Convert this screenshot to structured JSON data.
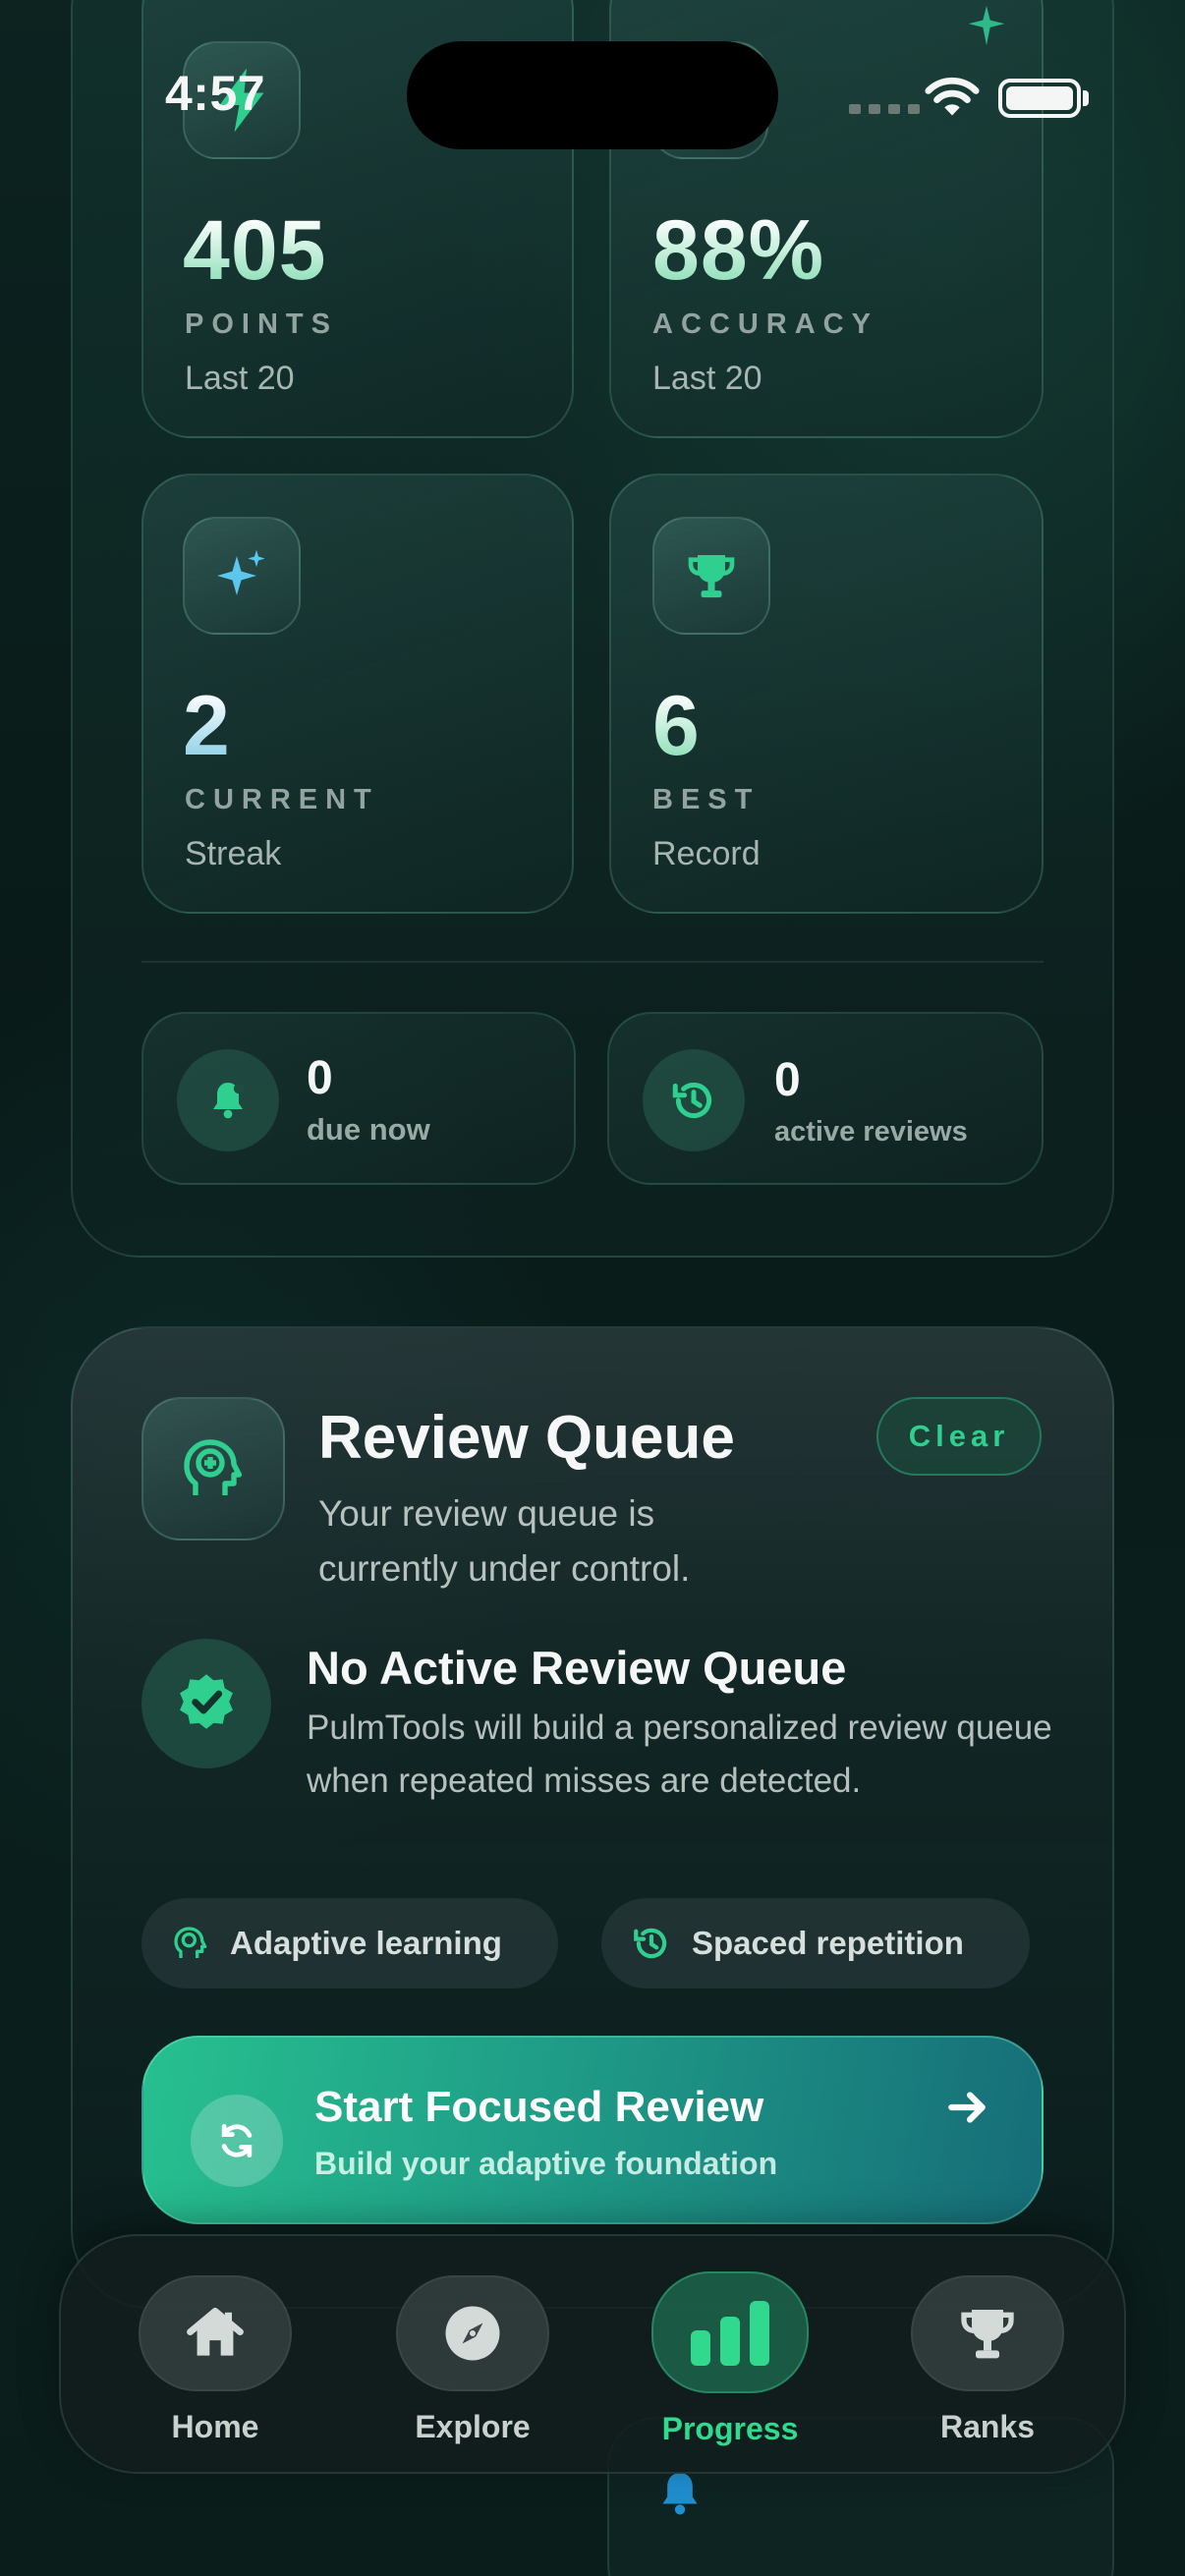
{
  "status_bar": {
    "time": "4:57"
  },
  "stats": {
    "points": {
      "value": "405",
      "label": "POINTS",
      "sub": "Last 20"
    },
    "accuracy": {
      "value": "88%",
      "label": "ACCURACY",
      "sub": "Last 20"
    },
    "streak": {
      "value": "2",
      "label": "CURRENT",
      "sub": "Streak"
    },
    "best": {
      "value": "6",
      "label": "BEST",
      "sub": "Record"
    }
  },
  "mini": {
    "due": {
      "value": "0",
      "label": "due now"
    },
    "active": {
      "value": "0",
      "label": "active reviews"
    }
  },
  "review_queue": {
    "title": "Review Queue",
    "subtitle": "Your review queue is currently under control.",
    "clear_label": "Clear",
    "empty_title": "No Active Review Queue",
    "empty_body": "PulmTools will build a personalized review queue when repeated misses are detected.",
    "chips": [
      "Adaptive learning",
      "Spaced repetition"
    ],
    "cta_title": "Start Focused Review",
    "cta_subtitle": "Build your adaptive foundation"
  },
  "tabs": [
    {
      "label": "Home",
      "icon": "house-icon",
      "active": false
    },
    {
      "label": "Explore",
      "icon": "compass-icon",
      "active": false
    },
    {
      "label": "Progress",
      "icon": "bar-chart-icon",
      "active": true
    },
    {
      "label": "Ranks",
      "icon": "trophy-icon",
      "active": false
    }
  ],
  "colors": {
    "accent": "#31d98f",
    "streak_icon": "#5cc6ee",
    "background": "#091a18"
  }
}
